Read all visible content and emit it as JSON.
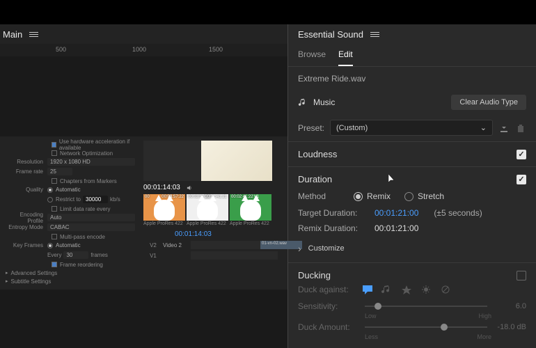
{
  "left": {
    "title": "Main",
    "ruler_ticks": [
      {
        "pos": 80,
        "label": "500"
      },
      {
        "pos": 190,
        "label": "1000"
      },
      {
        "pos": 300,
        "label": "1500"
      }
    ],
    "export": {
      "hw_accel_label": "Use hardware acceleration if available",
      "net_opt_label": "Network Optimization",
      "resolution_label": "Resolution",
      "resolution_value": "1920 x 1080 HD",
      "framerate_label": "Frame rate",
      "framerate_value": "25",
      "chapters_label": "Chapters from Markers",
      "quality_label": "Quality",
      "quality_auto": "Automatic",
      "restrict_label": "Restrict to",
      "restrict_value": "30000",
      "restrict_unit": "kb/s",
      "limit_rate_label": "Limit data rate every",
      "encoding_profile_label": "Encoding Profile",
      "encoding_profile_value": "Auto",
      "entropy_label": "Entropy Mode",
      "entropy_value": "CABAC",
      "multipass_label": "Multi-pass encode",
      "keyframes_label": "Key Frames",
      "keyframes_auto": "Automatic",
      "keyframes_every": "Every",
      "keyframes_frames": "frames",
      "reorder_label": "Frame reordering",
      "advanced_label": "Advanced Settings",
      "subtitle_label": "Subtitle Settings"
    },
    "preview": {
      "timecode": "00:01:14:03",
      "thumbs": [
        {
          "tc_l": "00",
          "tc_r": "00:03:57:22",
          "v": "V1",
          "label": "Apple ProRes 422"
        },
        {
          "tc_l": "00:03:57:23",
          "tc_r": "00:02:41:21",
          "v": "V1",
          "label": "Apple ProRes 422"
        },
        {
          "tc_l": "00:02:41:22",
          "tc_r": "",
          "v": "V1",
          "label": "Apple ProRes 422"
        }
      ]
    },
    "timeline": {
      "timecode": "00:01:14:03",
      "v2_label": "V2",
      "v2_name": "Video 2",
      "v1_label": "V1",
      "clip_name": "01-vn-02.wav"
    }
  },
  "right": {
    "panel_title": "Essential Sound",
    "tab_browse": "Browse",
    "tab_edit": "Edit",
    "filename": "Extreme Ride.wav",
    "type_label": "Music",
    "clear_btn": "Clear Audio Type",
    "preset_label": "Preset:",
    "preset_value": "(Custom)",
    "loudness_title": "Loudness",
    "duration_title": "Duration",
    "method_label": "Method",
    "remix_label": "Remix",
    "stretch_label": "Stretch",
    "target_label": "Target Duration:",
    "target_value": "00:01:21:00",
    "target_tolerance": "(±5 seconds)",
    "remix_dur_label": "Remix Duration:",
    "remix_dur_value": "00:01:21:00",
    "customize_label": "Customize",
    "ducking_title": "Ducking",
    "duck_against_label": "Duck against:",
    "sensitivity_label": "Sensitivity:",
    "sensitivity_value": "6.0",
    "sensitivity_low": "Low",
    "sensitivity_high": "High",
    "duck_amount_label": "Duck Amount:",
    "duck_amount_value": "-18.0 dB",
    "duck_less": "Less",
    "duck_more": "More"
  }
}
